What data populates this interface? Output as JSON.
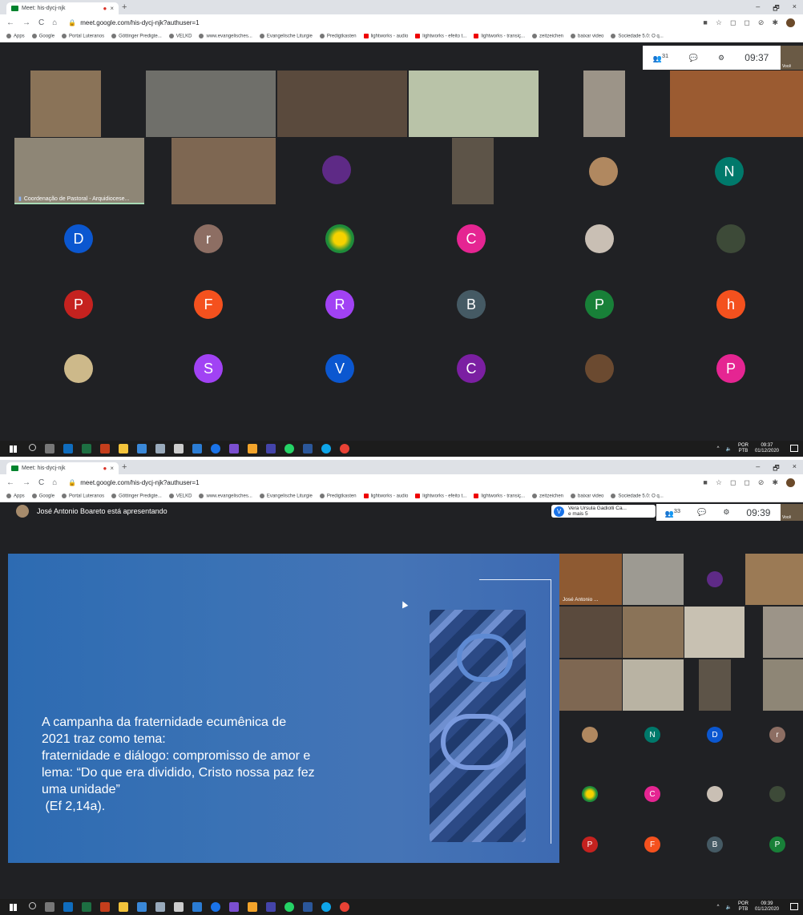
{
  "browser": {
    "tab_title": "Meet: his-dycj-njk",
    "tab_close": "×",
    "new_tab": "+",
    "url": "meet.google.com/his-dycj-njk?authuser=1",
    "window_controls": [
      "–",
      "🗗",
      "×"
    ],
    "nav_icons": [
      "←",
      "→",
      "C",
      "⌂"
    ],
    "right_icons": [
      "■",
      "☆",
      "◻",
      "◻",
      "⊘",
      "✱"
    ],
    "bookmarks": [
      "Apps",
      "Google",
      "Portal Luteranos",
      "Göttinger Predigte...",
      "VELKD",
      "www.evangelisches...",
      "Evangelische Liturgie",
      "Predigtkasten",
      "lightworks - audio",
      "lightworks - efeito t...",
      "lightworks - transiç...",
      "zeitzeichen",
      "baixar video",
      "Sociedade 5.0: O q..."
    ]
  },
  "screenshot1": {
    "participant_count": "31",
    "time": "09:37",
    "self_label": "Você",
    "pinned_caption": "Coordenação de Pastoral - Arquidiocese...",
    "avatars": [
      {
        "letter": "N",
        "color": "#00796b"
      },
      {
        "letter": "D",
        "color": "#0b57d0"
      },
      {
        "letter": "r",
        "color": "#8d6e63"
      },
      {
        "letter": "C",
        "color": "#e52592"
      },
      {
        "letter": "P",
        "color": "#c5221f"
      },
      {
        "letter": "F",
        "color": "#f4511e"
      },
      {
        "letter": "R",
        "color": "#a142f4"
      },
      {
        "letter": "B",
        "color": "#455a64"
      },
      {
        "letter": "P",
        "color": "#188038"
      },
      {
        "letter": "h",
        "color": "#f4511e"
      },
      {
        "letter": "S",
        "color": "#a142f4"
      },
      {
        "letter": "V",
        "color": "#0b57d0"
      },
      {
        "letter": "C",
        "color": "#7b1fa2"
      },
      {
        "letter": "P",
        "color": "#e52592"
      }
    ],
    "taskbar_time": "09:37",
    "taskbar_date": "01/12/2020",
    "taskbar_lang": "POR",
    "taskbar_lang2": "PTB"
  },
  "screenshot2": {
    "presenter_text": "José Antonio Boareto está apresentando",
    "chip_letter": "V",
    "chip_name": "Vera Ursula Gadiolli Ca...",
    "chip_more": "e mais 5",
    "participant_count": "33",
    "time": "09:39",
    "self_label": "Você",
    "side_caption": "José Antonio ...",
    "slide_lines": [
      "A campanha da fraternidade ecumênica de",
      "2021 traz como tema:",
      "fraternidade e diálogo: compromisso de amor e",
      "lema: “Do que era dividido, Cristo nossa paz fez",
      "uma unidade”",
      " (Ef 2,14a)."
    ],
    "side_avatars": [
      {
        "letter": "N",
        "color": "#00796b"
      },
      {
        "letter": "D",
        "color": "#0b57d0"
      },
      {
        "letter": "r",
        "color": "#8d6e63"
      },
      {
        "letter": "C",
        "color": "#e52592"
      },
      {
        "letter": "P",
        "color": "#c5221f"
      },
      {
        "letter": "F",
        "color": "#f4511e"
      },
      {
        "letter": "B",
        "color": "#455a64"
      },
      {
        "letter": "P",
        "color": "#188038"
      }
    ],
    "taskbar_time": "09:39",
    "taskbar_date": "01/12/2020",
    "taskbar_lang": "POR",
    "taskbar_lang2": "PTB"
  },
  "colors": {
    "meet_bg": "#202124",
    "slide_blue": "#3a72b5",
    "taskbar": "#1c1c1c"
  }
}
